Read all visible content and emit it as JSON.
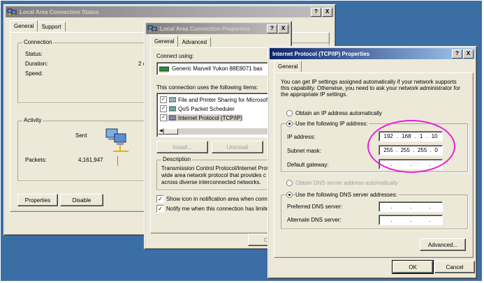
{
  "status_window": {
    "title": "Local Area Connection Status",
    "title_buttons": [
      "?",
      "X"
    ],
    "tabs": [
      "General",
      "Support"
    ],
    "connection_group": "Connection",
    "status_label": "Status:",
    "duration_label": "Duration:",
    "duration_value": "2 c",
    "speed_label": "Speed:",
    "activity_group": "Activity",
    "sent_label": "Sent",
    "packets_label": "Packets:",
    "packets_sent": "4,161,947",
    "properties_button": "Properties",
    "disable_button": "Disable"
  },
  "props_window": {
    "title": "Local Area Connection Properties",
    "title_buttons": [
      "?",
      "X"
    ],
    "tabs": [
      "General",
      "Advanced"
    ],
    "connect_using_label": "Connect using:",
    "adapter_name": "Generic Marvell Yukon 88E8071 bas",
    "items_label": "This connection uses the following items:",
    "items": [
      {
        "label": "File and Printer Sharing for Microsoft",
        "checked": true
      },
      {
        "label": "QoS Packet Scheduler",
        "checked": true
      },
      {
        "label": "Internet Protocol (TCP/IP)",
        "checked": true
      }
    ],
    "install_button": "Install...",
    "uninstall_button": "Uninstall",
    "description_group": "Description",
    "description_text": [
      "Transmission Control Protocol/Internet Prot",
      "wide area network protocol that provides c",
      "across diverse interconnected networks."
    ],
    "show_icon_label": "Show icon in notification area when conne",
    "notify_label": "Notify me when this connection has limited",
    "ok_partial": "O"
  },
  "tcpip_window": {
    "title": "Internet Protocol (TCP/IP) Properties",
    "title_buttons": [
      "?",
      "X"
    ],
    "tab": "General",
    "intro": [
      "You can get IP settings assigned automatically if your network supports",
      "this capability. Otherwise, you need to ask your network administrator for",
      "the appropriate IP settings."
    ],
    "obtain_ip_auto": "Obtain an IP address automatically",
    "use_following_ip": "Use the following IP address:",
    "ip_label": "IP address:",
    "ip_value": [
      "192",
      "168",
      "1",
      "10"
    ],
    "subnet_label": "Subnet mask:",
    "subnet_value": [
      "255",
      "255",
      "255",
      "0"
    ],
    "gateway_label": "Default gateway:",
    "obtain_dns_auto": "Obtain DNS server address automatically",
    "use_following_dns": "Use the following DNS server addresses:",
    "preferred_dns_label": "Preferred DNS server:",
    "alternate_dns_label": "Alternate DNS server:",
    "advanced_button": "Advanced...",
    "ok_button": "OK",
    "cancel_button": "Cancel",
    "highlight_color": "#e81fd4"
  }
}
